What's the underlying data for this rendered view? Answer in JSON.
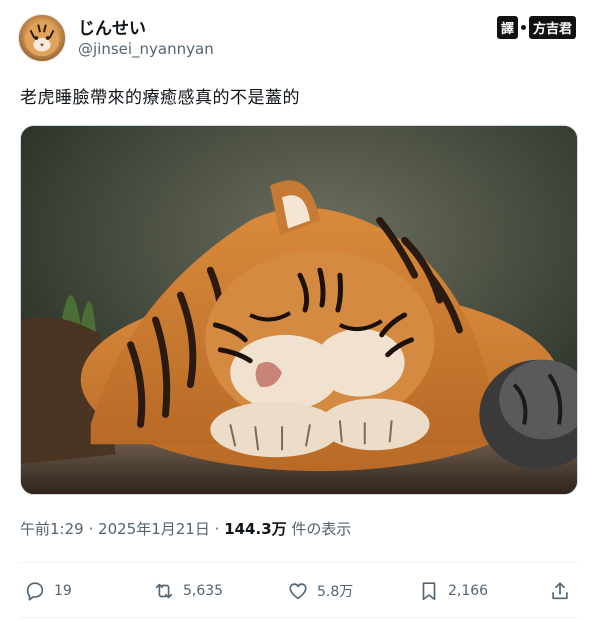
{
  "author": {
    "display_name": "じんせい",
    "handle": "@jinsei_nyannyan"
  },
  "watermark": {
    "left": "譯",
    "right": "方吉君"
  },
  "post": {
    "text": "老虎睡臉帶來的療癒感真的不是蓋的",
    "image_subject": "sleeping tiger"
  },
  "meta": {
    "time": "午前1:29",
    "sep1": "·",
    "date": "2025年1月21日",
    "sep2": "·",
    "views": "144.3万",
    "views_label": " 件の表示"
  },
  "actions": {
    "replies": "19",
    "reposts": "5,635",
    "likes": "5.8万",
    "bookmarks": "2,166"
  },
  "icons": {
    "reply": "reply-icon",
    "repost": "repost-icon",
    "like": "heart-icon",
    "bookmark": "bookmark-icon",
    "share": "share-icon"
  },
  "colors": {
    "text_primary": "#0f1419",
    "text_secondary": "#536471"
  }
}
